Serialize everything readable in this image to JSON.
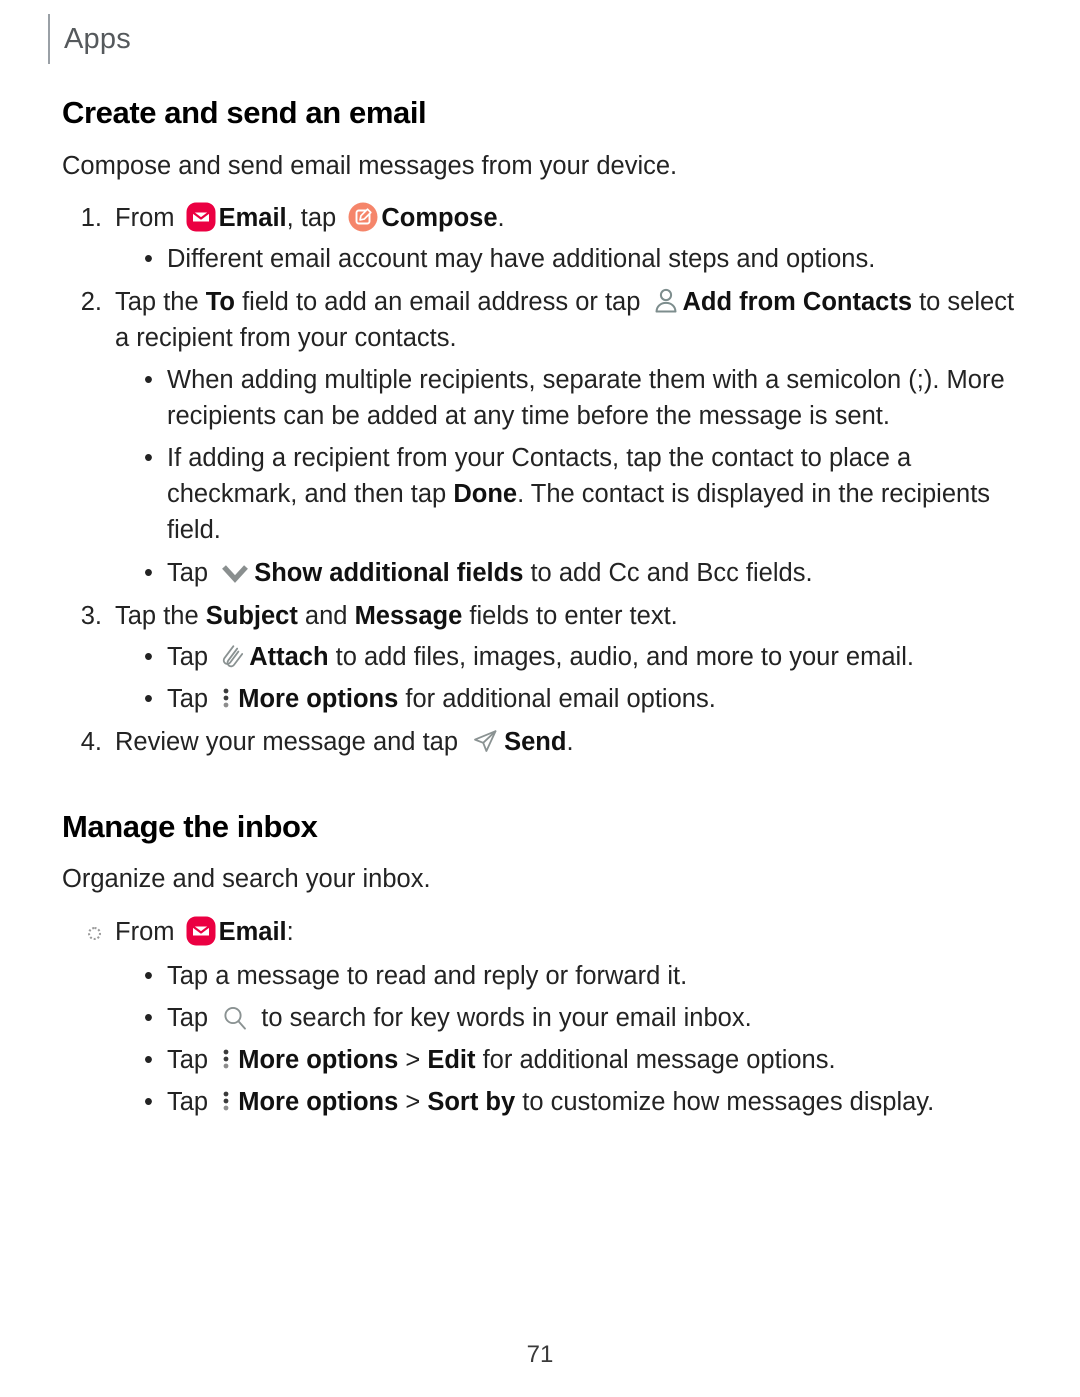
{
  "header": {
    "label": "Apps"
  },
  "colors": {
    "email_icon_bg": "#EB0042",
    "compose_icon_bg": "#F5856A",
    "outline_icon": "#7d8d8d",
    "header_text": "#55595c",
    "body_text": "#232323"
  },
  "sections": [
    {
      "title": "Create and send an email",
      "intro": "Compose and send email messages from your device."
    },
    {
      "title": "Manage the inbox",
      "intro": "Organize and search your inbox."
    }
  ],
  "steps": {
    "s1": {
      "marker": "1.",
      "t1": "From ",
      "email_label": "Email",
      "t2": ", tap ",
      "compose_label": "Compose",
      "t3": ".",
      "sub1": "Different email account may have additional steps and options."
    },
    "s2": {
      "marker": "2.",
      "t1": "Tap the ",
      "b_to": "To",
      "t2": " field to add an email address or tap ",
      "b_contacts": "Add from Contacts",
      "t3": " to select a recipient from your contacts.",
      "sub1": "When adding multiple recipients, separate them with a semicolon (;). More recipients can be added at any time before the message is sent.",
      "sub2_a": "If adding a recipient from your Contacts, tap the contact to place a checkmark, and then tap ",
      "sub2_b": "Done",
      "sub2_c": ". The contact is displayed in the recipients field.",
      "sub3_a": "Tap ",
      "sub3_b": "Show additional fields",
      "sub3_c": " to add Cc and Bcc fields."
    },
    "s3": {
      "marker": "3.",
      "t1": "Tap the ",
      "b_subject": "Subject",
      "t2": " and ",
      "b_message": "Message",
      "t3": " fields to enter text.",
      "sub1_a": "Tap ",
      "sub1_b": "Attach",
      "sub1_c": " to add files, images, audio, and more to your email.",
      "sub2_a": "Tap ",
      "sub2_b": "More options",
      "sub2_c": " for additional email options."
    },
    "s4": {
      "marker": "4.",
      "t1": "Review your message and tap ",
      "b_send": "Send",
      "t2": "."
    }
  },
  "inbox": {
    "from_a": "From ",
    "email_label": "Email",
    "from_b": ":",
    "b1": "Tap a message to read and reply or forward it.",
    "b2_a": "Tap ",
    "b2_b": " to search for key words in your email inbox.",
    "b3_a": "Tap ",
    "b3_b": "More options",
    "b3_sep": " > ",
    "b3_c": "Edit",
    "b3_d": " for additional message options.",
    "b4_a": "Tap ",
    "b4_b": "More options",
    "b4_sep": " > ",
    "b4_c": "Sort by",
    "b4_d": " to customize how messages display."
  },
  "icons": {
    "email": "email-app-icon",
    "compose": "compose-icon",
    "contacts": "add-from-contacts-icon",
    "chevron": "chevron-down-icon",
    "attach": "paperclip-attach-icon",
    "more": "more-options-icon",
    "send": "send-icon",
    "search": "search-icon"
  },
  "footer": {
    "page_number": "71"
  },
  "bullets": {
    "dot": "•"
  }
}
